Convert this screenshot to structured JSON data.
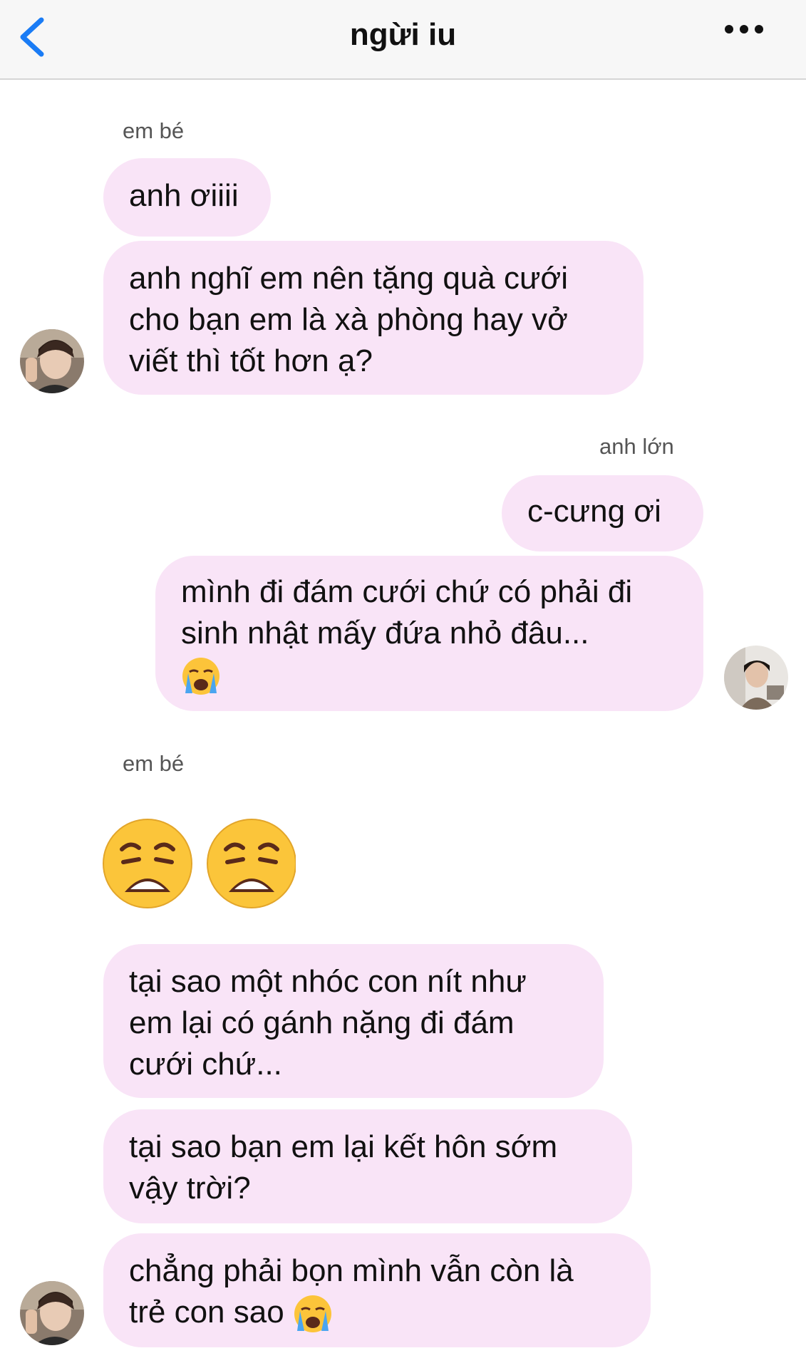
{
  "header": {
    "title": "ngừi iu",
    "back_icon": "chevron-left-icon",
    "more_icon": "more-horizontal-icon",
    "accent_color": "#1a7cf5"
  },
  "groups": [
    {
      "sender": "em bé",
      "side": "left",
      "messages": [
        "anh ơiiii",
        "anh nghĩ em nên tặng quà cưới cho bạn em là xà phòng hay vở viết thì tốt hơn ạ?"
      ]
    },
    {
      "sender": "anh lớn",
      "side": "right",
      "messages": [
        "c-cưng ơi",
        "mình đi đám cưới chứ có phải đi sinh nhật mấy đứa nhỏ đâu... 😭"
      ]
    },
    {
      "sender": "em bé",
      "side": "left",
      "messages": [
        "😩😩",
        "tại sao một nhóc con nít như em lại có gánh nặng đi đám cưới chứ...",
        "tại sao bạn em lại kết hôn sớm vậy trời?",
        "chẳng phải bọn mình vẫn còn là trẻ con sao 😭"
      ]
    }
  ],
  "bubble_color": "#f9e4f7",
  "display": {
    "m1": "anh ơiiii",
    "m2_lines": [
      "anh nghĩ em nên tặng quà cưới",
      "cho bạn em là xà phòng hay vở",
      "viết thì tốt hơn ạ?"
    ],
    "m3": "c-cưng ơi",
    "m4_lines": [
      "mình đi đám cưới chứ có phải đi",
      "sinh nhật mấy đứa nhỏ đâu..."
    ],
    "m6_lines": [
      "tại sao một nhóc con nít như",
      "em lại có gánh nặng đi đám",
      "cưới chứ..."
    ],
    "m7_lines": [
      "tại sao bạn em lại kết hôn sớm",
      "vậy trời?"
    ],
    "m8_lines": [
      "chẳng phải bọn mình vẫn còn là",
      "trẻ con sao"
    ]
  }
}
